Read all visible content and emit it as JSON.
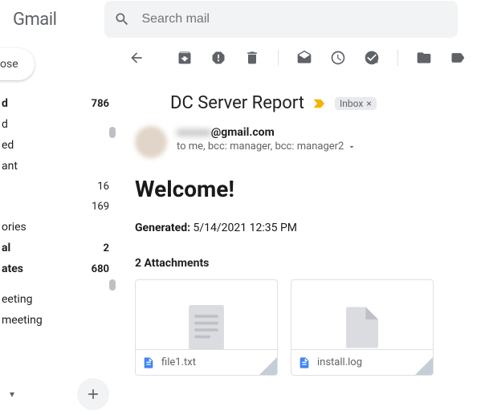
{
  "header": {
    "logo": "Gmail",
    "search_placeholder": "Search mail"
  },
  "sidebar": {
    "compose_visible_text": "ose",
    "items": [
      {
        "label": "d",
        "count": "786",
        "bold": true
      },
      {
        "label": "d",
        "count": ""
      },
      {
        "label": "ed",
        "count": ""
      },
      {
        "label": "ant",
        "count": ""
      },
      {
        "label": "",
        "count": "16"
      },
      {
        "label": "",
        "count": "169"
      },
      {
        "label": "ories",
        "count": ""
      },
      {
        "label": "al",
        "count": "2",
        "bold": true
      },
      {
        "label": "ates",
        "count": "680",
        "bold": true
      },
      {
        "label": "eeting",
        "count": ""
      },
      {
        "label": "meeting",
        "count": ""
      }
    ]
  },
  "toolbar": {
    "back": "back",
    "archive": "archive",
    "spam": "report-spam",
    "delete": "delete",
    "unread": "mark-unread",
    "snooze": "snooze",
    "tasks": "add-to-tasks",
    "move": "move-to",
    "labels": "labels"
  },
  "email": {
    "subject": "DC Server Report",
    "label_chip": "Inbox",
    "sender_suffix": "@gmail.com",
    "recipients": "to me, bcc: manager, bcc: manager2",
    "body_heading": "Welcome!",
    "generated_label": "Generated:",
    "generated_value": "5/14/2021 12:35 PM",
    "attachments_header": "2 Attachments",
    "attachments": [
      {
        "name": "file1.txt"
      },
      {
        "name": "install.log"
      }
    ]
  }
}
